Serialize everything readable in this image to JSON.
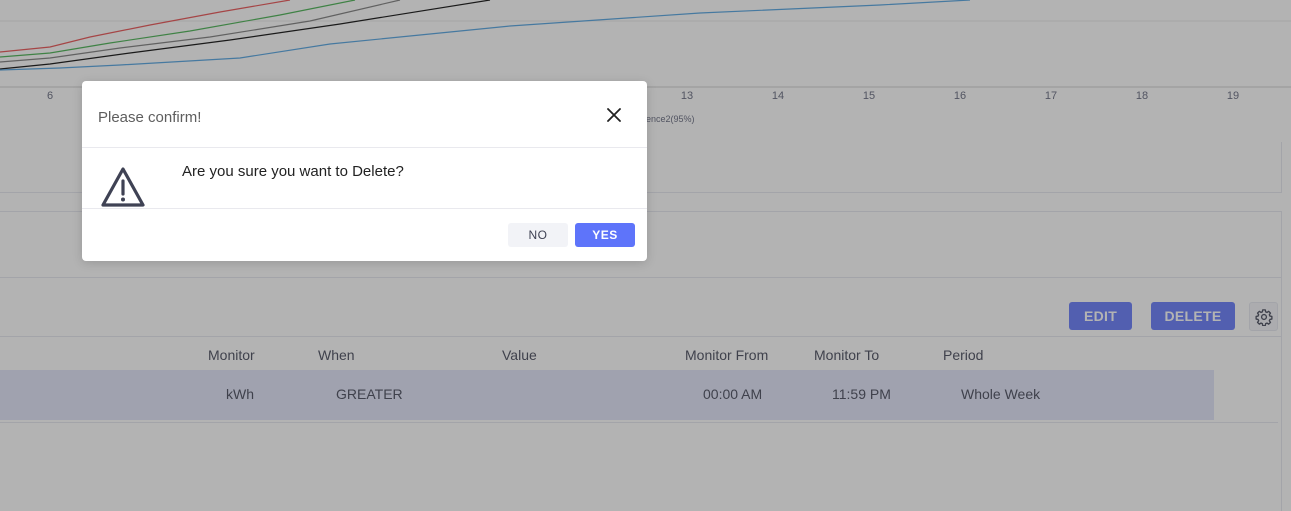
{
  "chart": {
    "x_ticks": [
      "6",
      "13",
      "14",
      "15",
      "16",
      "17",
      "18",
      "19"
    ],
    "legend_fragment": "ence2(95%)",
    "series_colors": [
      "#e8494a",
      "#3fae49",
      "#777777",
      "#000000",
      "#4a9fe0"
    ]
  },
  "toolbar": {
    "edit_label": "EDIT",
    "delete_label": "DELETE",
    "settings_icon": "gear-icon"
  },
  "table": {
    "headers": {
      "monitor": "Monitor",
      "when": "When",
      "value": "Value",
      "monitor_from": "Monitor From",
      "monitor_to": "Monitor To",
      "period": "Period"
    },
    "rows": [
      {
        "monitor": "kWh",
        "when": "GREATER",
        "value": "",
        "monitor_from": "00:00 AM",
        "monitor_to": "11:59 PM",
        "period": "Whole Week"
      }
    ]
  },
  "modal": {
    "title": "Please confirm!",
    "message": "Are you sure you want to Delete?",
    "no_label": "NO",
    "yes_label": "YES",
    "warning_icon": "warning-icon",
    "close_icon": "close-icon"
  },
  "colors": {
    "accent": "#5e74fa",
    "row_highlight": "#dfe3f8",
    "overlay": "rgba(64,64,64,0.4)"
  }
}
